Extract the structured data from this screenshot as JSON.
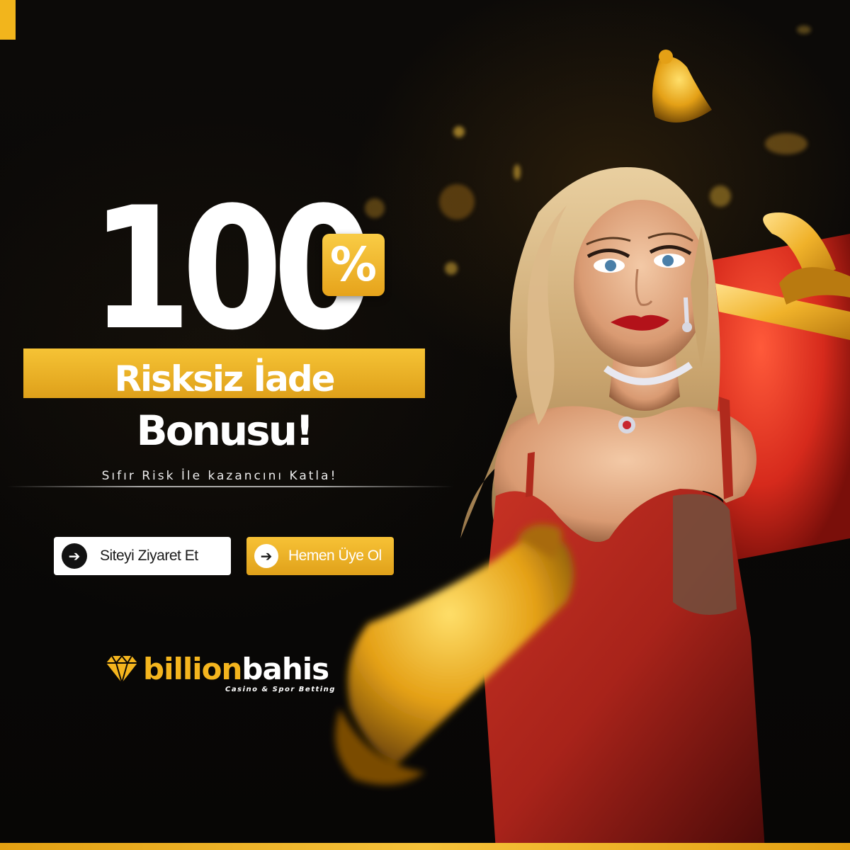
{
  "headline": {
    "number": "100",
    "percent_symbol": "%",
    "band_text": "Risksiz İade",
    "bonus_text": "Bonusu!",
    "tagline": "Sıfır Risk İle kazancını Katla!"
  },
  "buttons": {
    "visit_label": "Siteyi Ziyaret Et",
    "join_label": "Hemen Üye Ol",
    "arrow_icon": "arrow-right-icon"
  },
  "brand": {
    "name_part1": "billion",
    "name_part2": "bahis",
    "subtitle": "Casino & Spor Betting",
    "logo_icon": "diamond-icon"
  },
  "colors": {
    "gold": "#f2b51c",
    "background": "#0a0806",
    "white": "#ffffff",
    "dress_red": "#a8231a"
  },
  "illustration": {
    "subject": "woman-in-red-dress",
    "props": [
      "gift-box-icon",
      "bell-icon"
    ]
  }
}
